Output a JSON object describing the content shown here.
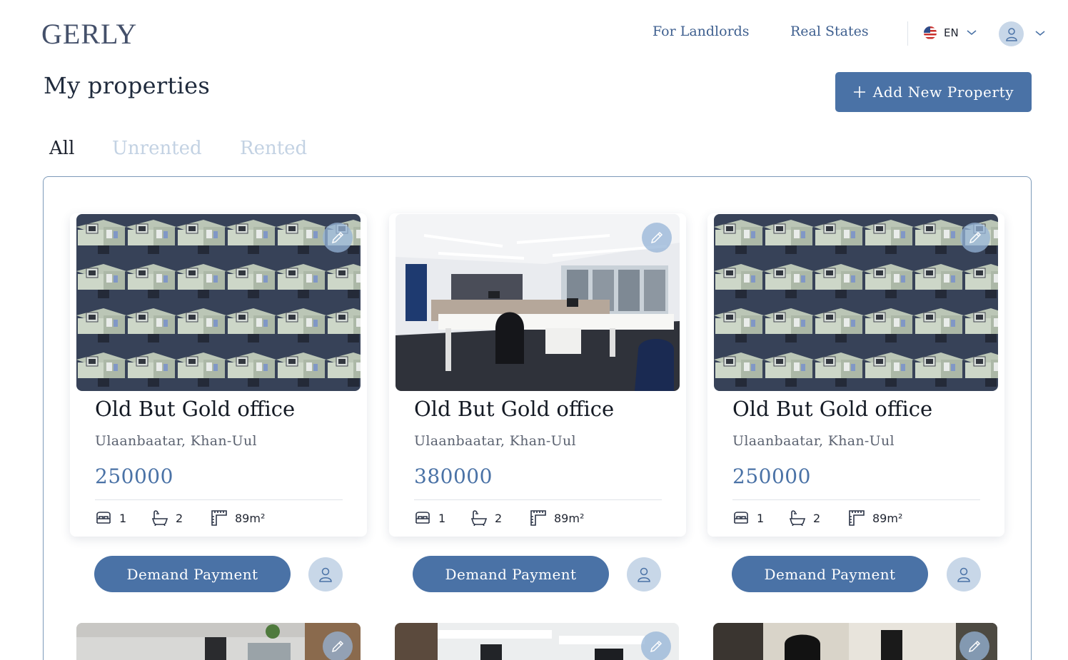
{
  "header": {
    "logo": "GERLY",
    "nav": [
      "For Landlords",
      "Real States"
    ],
    "language": "EN"
  },
  "page": {
    "title": "My properties",
    "add_button": "Add New Property",
    "tabs": [
      "All",
      "Unrented",
      "Rented"
    ],
    "active_tab": "All"
  },
  "properties": [
    {
      "title": "Old But Gold office",
      "location": "Ulaanbaatar, Khan-Uul",
      "price": "250000",
      "beds": "1",
      "baths": "2",
      "area": "89m²",
      "action": "Demand Payment",
      "image": "cubicle-office"
    },
    {
      "title": "Old But Gold office",
      "location": "Ulaanbaatar, Khan-Uul",
      "price": "380000",
      "beds": "1",
      "baths": "2",
      "area": "89m²",
      "action": "Demand Payment",
      "image": "open-plan-office"
    },
    {
      "title": "Old But Gold office",
      "location": "Ulaanbaatar, Khan-Uul",
      "price": "250000",
      "beds": "1",
      "baths": "2",
      "area": "89m²",
      "action": "Demand Payment",
      "image": "cubicle-office"
    }
  ],
  "more_properties": [
    {
      "image": "modern-office"
    },
    {
      "image": "white-desk-office"
    },
    {
      "image": "house-exterior"
    }
  ],
  "colors": {
    "accent": "#4a72a6",
    "accent_light": "#c8d7e8",
    "tab_inactive": "#c3d2e3",
    "panel_border": "#7c9ab9"
  }
}
